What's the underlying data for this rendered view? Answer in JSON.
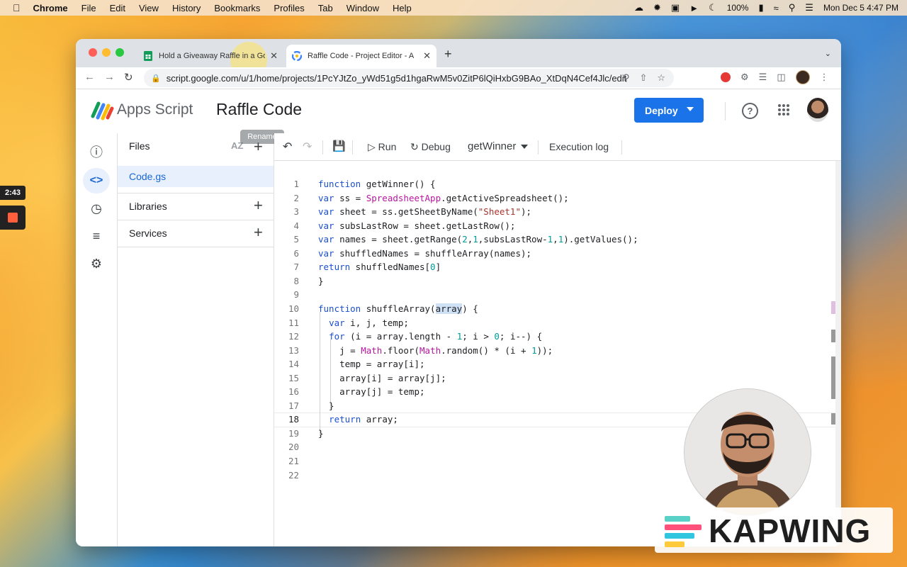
{
  "menubar": {
    "app": "Chrome",
    "items": [
      "File",
      "Edit",
      "View",
      "History",
      "Bookmarks",
      "Profiles",
      "Tab",
      "Window",
      "Help"
    ],
    "battery": "100%",
    "datetime": "Mon Dec 5  4:47 PM"
  },
  "tabs": [
    {
      "title": "Hold a Giveaway Raffle in a Go",
      "icon": "sheets-icon",
      "active": false
    },
    {
      "title": "Raffle Code - Project Editor - A",
      "icon": "apps-script-icon",
      "active": true
    }
  ],
  "address": {
    "url": "script.google.com/u/1/home/projects/1PcYJtZo_yWd51g5d1hgaRwM5v0ZitP6lQiHxbG9BAo_XtDqN4Cef4Jlc/edit"
  },
  "header": {
    "product": "Apps Script",
    "project_title": "Raffle Code",
    "deploy_label": "Deploy"
  },
  "files_panel": {
    "title": "Files",
    "sort_label": "AZ",
    "tooltip": "Rename",
    "file": "Code.gs",
    "sections": [
      "Libraries",
      "Services"
    ]
  },
  "editor_toolbar": {
    "run": "Run",
    "debug": "Debug",
    "function": "getWinner",
    "exec_log": "Execution log"
  },
  "code": {
    "current_line": 18,
    "lines": [
      "function getWinner() {",
      "var ss = SpreadsheetApp.getActiveSpreadsheet();",
      "var sheet = ss.getSheetByName(\"Sheet1\");",
      "var subsLastRow = sheet.getLastRow();",
      "var names = sheet.getRange(2,1,subsLastRow-1,1).getValues();",
      "var shuffledNames = shuffleArray(names);",
      "return shuffledNames[0]",
      "}",
      "",
      "function shuffleArray(array) {",
      "  var i, j, temp;",
      "  for (i = array.length - 1; i > 0; i--) {",
      "    j = Math.floor(Math.random() * (i + 1));",
      "    temp = array[i];",
      "    array[i] = array[j];",
      "    array[j] = temp;",
      "  }",
      "  return array;",
      "}",
      "",
      "",
      ""
    ]
  },
  "recorder": {
    "time": "2:43"
  },
  "watermark": {
    "text": "KAPWING"
  },
  "colors": {
    "accent": "#1a73e8",
    "keyword": "#1a4fd0",
    "class": "#b5179e",
    "string": "#a8342b",
    "number": "#009999"
  }
}
